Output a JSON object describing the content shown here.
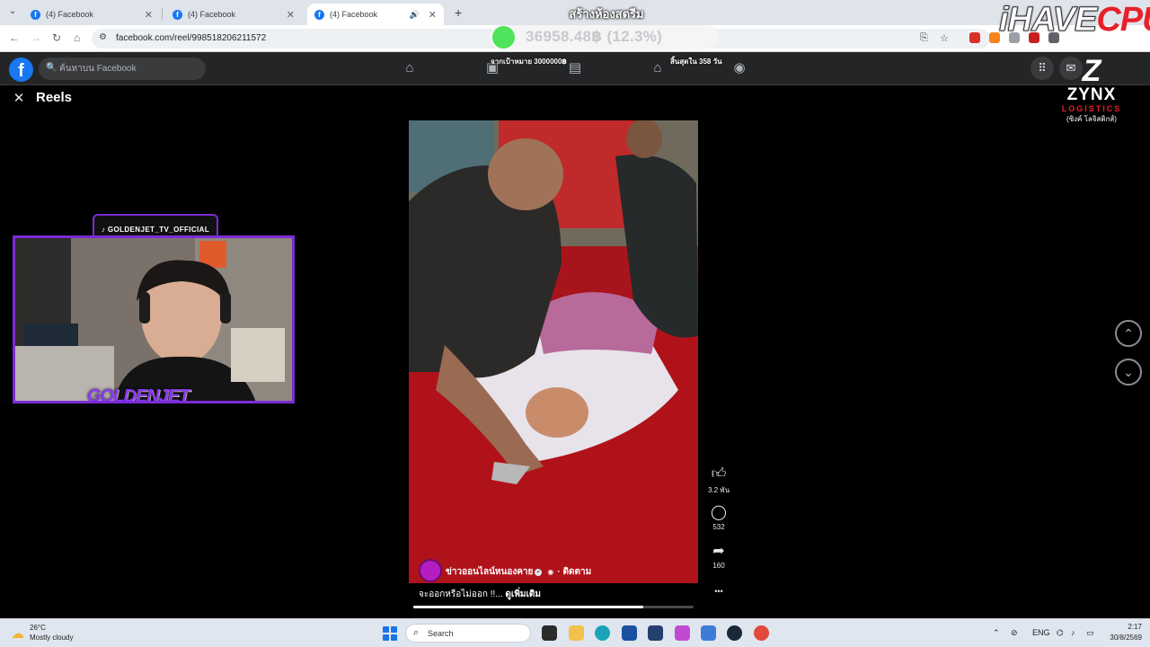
{
  "browser": {
    "tabs": [
      {
        "title": "(4) Facebook",
        "active": false
      },
      {
        "title": "(4) Facebook",
        "active": false
      },
      {
        "title": "(4) Facebook",
        "active": true
      }
    ],
    "new_tab_label": "+",
    "url": "facebook.com/reel/998518206211572"
  },
  "stream_overlay": {
    "title": "สร้างห้องสตรีม",
    "donation_amount": "36958.48฿ (12.3%)",
    "donation_progress_pct": 12.3,
    "brand": {
      "part1": "iHAVE",
      "part2": "CPU"
    },
    "goal_text": "จากเป้าหมาย 3000000฿",
    "days_left_text": "สิ้นสุดใน 358 วัน",
    "sponsor": {
      "mark": "Z",
      "name": "ZYNX",
      "sub": "LOGISTICS",
      "thai": "(ซิงค์ โลจิสติกส์)"
    },
    "webcam": {
      "handle": "♪ GOLDENJET_TV_OFFICIAL",
      "name": "GOLDENJET"
    }
  },
  "facebook": {
    "search_placeholder": "ค้นหาบน Facebook",
    "logo": "f",
    "nav_icons": [
      "home-icon",
      "video-icon",
      "stats-icon",
      "marketplace-icon",
      "groups-icon"
    ],
    "reels_title": "Reels",
    "reel": {
      "author": "ข่าวออนไลน์หนองคาย",
      "follow_label": "ติดตาม",
      "separator": "·",
      "caption": "จะออกหรือไม่ออก !!...",
      "see_more": "ดูเพิ่มเติม",
      "progress_pct": 82,
      "likes": "3.2 พัน",
      "comments": "532",
      "shares": "160",
      "more": "•••"
    }
  },
  "taskbar": {
    "weather_temp": "26°C",
    "weather_desc": "Mostly cloudy",
    "search_label": "Search",
    "language": "ENG",
    "time": "2:17",
    "date": "30/8/2569"
  },
  "colors": {
    "facebook_blue": "#1877f2",
    "webcam_frame": "#7b2cd6",
    "brand_red": "#e8202a",
    "donation_green": "#4ee35a"
  }
}
